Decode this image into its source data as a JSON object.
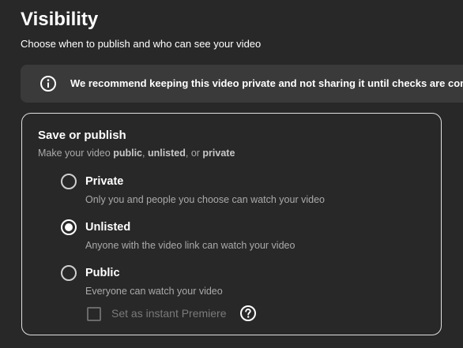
{
  "header": {
    "title": "Visibility",
    "subtitle": "Choose when to publish and who can see your video"
  },
  "banner": {
    "icon": "info-icon",
    "text": "We recommend keeping this video private and not sharing it until checks are complete"
  },
  "card": {
    "title": "Save or publish",
    "description": {
      "prefix": "Make your video ",
      "public": "public",
      "sep1": ", ",
      "unlisted": "unlisted",
      "sep2": ", or ",
      "private": "private"
    },
    "options": [
      {
        "label": "Private",
        "description": "Only you and people you choose can watch your video",
        "selected": false
      },
      {
        "label": "Unlisted",
        "description": "Anyone with the video link can watch your video",
        "selected": true
      },
      {
        "label": "Public",
        "description": "Everyone can watch your video",
        "selected": false
      }
    ],
    "premiere": {
      "label": "Set as instant Premiere",
      "checked": false,
      "disabled": true,
      "help_icon": "help-circle-icon"
    }
  },
  "colors": {
    "background": "#282828",
    "banner_background": "#3a3a3a",
    "card_border": "#e0e0e0",
    "text_primary": "#ffffff",
    "text_secondary": "#aaaaaa",
    "text_disabled": "#7a7a7a"
  }
}
